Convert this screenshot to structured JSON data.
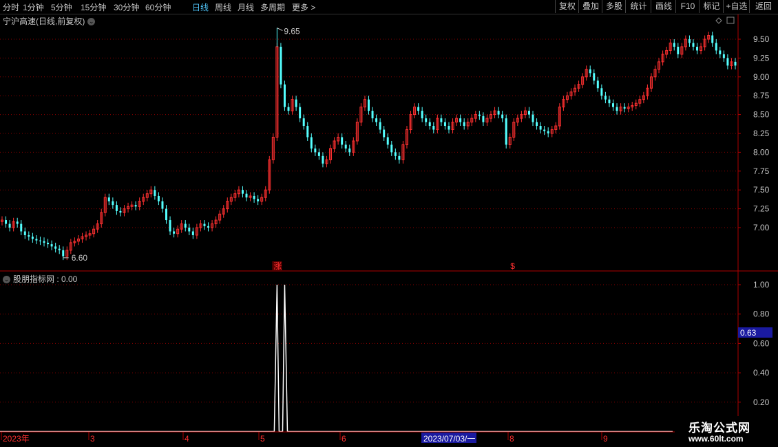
{
  "toolbar": {
    "tabs": [
      "分时",
      "1分钟",
      "5分钟",
      "15分钟",
      "30分钟",
      "60分钟",
      "日线",
      "周线",
      "月线",
      "多周期",
      "更多 >"
    ],
    "active_tab": "日线",
    "right_buttons": [
      "复权",
      "叠加",
      "多股",
      "统计",
      "画线",
      "F10",
      "标记",
      "+自选",
      "返回"
    ]
  },
  "colors": {
    "up": "#ff3030",
    "down": "#54ffff",
    "grid": "#8b0000",
    "axis": "#b00000",
    "line": "#ffffff",
    "highlight_bg": "#1a1aa0"
  },
  "main_panel": {
    "title": "宁沪高速(日线,前复权)",
    "high_label": "9.65",
    "low_label": "6.60",
    "markers": [
      "涨",
      "$"
    ]
  },
  "indicator_panel": {
    "title": "股朋指标网 : 0.00",
    "cursor_value": "0.63"
  },
  "x_axis": {
    "labels": [
      "2023年",
      "3",
      "4",
      "5",
      "6",
      "8",
      "9"
    ],
    "cursor_date": "2023/07/03/一"
  },
  "watermark": {
    "title": "乐淘公式网",
    "url": "www.60lt.com"
  },
  "chart_data": [
    {
      "type": "candlestick",
      "title": "宁沪高速(日线,前复权)",
      "y_ticks": [
        "9.50",
        "9.25",
        "9.00",
        "8.75",
        "8.50",
        "8.25",
        "8.00",
        "7.75",
        "7.50",
        "7.25",
        "7.00"
      ],
      "ylim": [
        6.5,
        9.75
      ],
      "close": [
        7.1,
        7.05,
        7.0,
        7.08,
        7.05,
        6.95,
        6.9,
        6.88,
        6.85,
        6.83,
        6.82,
        6.8,
        6.78,
        6.75,
        6.72,
        6.7,
        6.62,
        6.7,
        6.8,
        6.82,
        6.85,
        6.88,
        6.9,
        6.92,
        6.98,
        7.05,
        7.2,
        7.4,
        7.35,
        7.3,
        7.22,
        7.2,
        7.25,
        7.28,
        7.3,
        7.28,
        7.35,
        7.4,
        7.45,
        7.5,
        7.42,
        7.35,
        7.25,
        7.1,
        6.95,
        6.92,
        6.98,
        7.05,
        7.0,
        6.95,
        6.9,
        7.0,
        7.05,
        7.02,
        7.0,
        7.05,
        7.1,
        7.18,
        7.25,
        7.35,
        7.4,
        7.45,
        7.5,
        7.45,
        7.4,
        7.42,
        7.38,
        7.35,
        7.4,
        7.5,
        7.9,
        8.2,
        9.4,
        8.9,
        8.6,
        8.55,
        8.7,
        8.6,
        8.45,
        8.35,
        8.2,
        8.05,
        8.0,
        7.95,
        7.85,
        7.9,
        8.05,
        8.15,
        8.2,
        8.1,
        8.05,
        8.0,
        8.15,
        8.4,
        8.6,
        8.7,
        8.55,
        8.45,
        8.4,
        8.3,
        8.2,
        8.1,
        8.0,
        7.95,
        7.9,
        8.1,
        8.3,
        8.5,
        8.6,
        8.55,
        8.45,
        8.4,
        8.35,
        8.3,
        8.45,
        8.4,
        8.35,
        8.3,
        8.4,
        8.45,
        8.4,
        8.35,
        8.4,
        8.45,
        8.5,
        8.48,
        8.4,
        8.45,
        8.5,
        8.55,
        8.5,
        8.45,
        8.1,
        8.2,
        8.4,
        8.45,
        8.5,
        8.55,
        8.5,
        8.4,
        8.35,
        8.3,
        8.28,
        8.25,
        8.3,
        8.35,
        8.6,
        8.7,
        8.75,
        8.8,
        8.85,
        8.9,
        9.0,
        9.1,
        9.05,
        8.95,
        8.85,
        8.75,
        8.7,
        8.65,
        8.6,
        8.55,
        8.6,
        8.58,
        8.6,
        8.62,
        8.65,
        8.7,
        8.75,
        8.85,
        9.0,
        9.1,
        9.2,
        9.3,
        9.35,
        9.45,
        9.4,
        9.3,
        9.4,
        9.5,
        9.45,
        9.4,
        9.35,
        9.4,
        9.5,
        9.55,
        9.45,
        9.35,
        9.3,
        9.25,
        9.15,
        9.2,
        9.15
      ],
      "annotations": [
        {
          "text": "9.65",
          "value": 9.65
        },
        {
          "text": "6.60",
          "value": 6.6
        }
      ],
      "markers": [
        {
          "text": "涨",
          "index": 72
        },
        {
          "text": "$",
          "index": 134
        }
      ]
    },
    {
      "type": "line",
      "title": "股朋指标网 : 0.00",
      "y_ticks": [
        "1.00",
        "0.80",
        "0.60",
        "0.40",
        "0.20"
      ],
      "ylim": [
        0,
        1.05
      ],
      "x_range": [
        0,
        182
      ],
      "spikes": [
        72,
        74
      ],
      "spike_value": 1.0,
      "baseline": 0.0
    }
  ]
}
